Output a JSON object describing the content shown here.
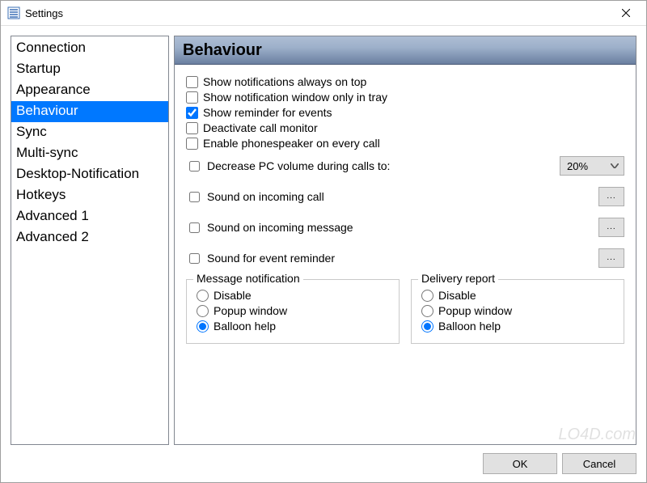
{
  "window": {
    "title": "Settings"
  },
  "sidebar": {
    "items": [
      {
        "key": "connection",
        "label": "Connection",
        "selected": false
      },
      {
        "key": "startup",
        "label": "Startup",
        "selected": false
      },
      {
        "key": "appearance",
        "label": "Appearance",
        "selected": false
      },
      {
        "key": "behaviour",
        "label": "Behaviour",
        "selected": true
      },
      {
        "key": "sync",
        "label": "Sync",
        "selected": false
      },
      {
        "key": "multi-sync",
        "label": "Multi-sync",
        "selected": false
      },
      {
        "key": "desktop-notification",
        "label": "Desktop-Notification",
        "selected": false
      },
      {
        "key": "hotkeys",
        "label": "Hotkeys",
        "selected": false
      },
      {
        "key": "advanced-1",
        "label": "Advanced 1",
        "selected": false
      },
      {
        "key": "advanced-2",
        "label": "Advanced 2",
        "selected": false
      }
    ]
  },
  "main": {
    "heading": "Behaviour",
    "options": {
      "always_on_top": {
        "label": "Show notifications always on top",
        "checked": false
      },
      "only_in_tray": {
        "label": "Show notification window only in tray",
        "checked": false
      },
      "reminder_events": {
        "label": "Show reminder for events",
        "checked": true
      },
      "deactivate_call_monitor": {
        "label": "Deactivate call monitor",
        "checked": false
      },
      "phonespeaker": {
        "label": "Enable phonespeaker on every call",
        "checked": false
      },
      "decrease_volume": {
        "label": "Decrease PC volume during calls to:",
        "checked": false,
        "value": "20%"
      },
      "sound_incoming_call": {
        "label": "Sound on incoming call",
        "checked": false
      },
      "sound_incoming_message": {
        "label": "Sound on incoming message",
        "checked": false
      },
      "sound_event_reminder": {
        "label": "Sound for event reminder",
        "checked": false
      }
    },
    "message_notification": {
      "legend": "Message notification",
      "options": [
        "Disable",
        "Popup window",
        "Balloon help"
      ],
      "selected": "Balloon help"
    },
    "delivery_report": {
      "legend": "Delivery report",
      "options": [
        "Disable",
        "Popup window",
        "Balloon help"
      ],
      "selected": "Balloon help"
    }
  },
  "footer": {
    "ok": "OK",
    "cancel": "Cancel"
  },
  "watermark": "LO4D.com",
  "browse_label": "..."
}
